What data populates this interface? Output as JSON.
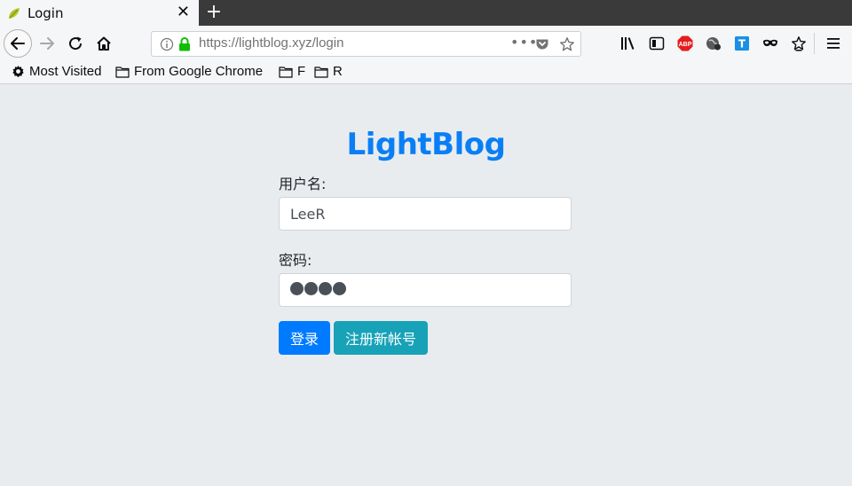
{
  "browser": {
    "tab": {
      "title": "Login",
      "favicon": "spring-leaf-icon"
    },
    "url": "https://lightblog.xyz/login",
    "url_actions": "•••",
    "bookmarks": [
      {
        "label": "Most Visited",
        "icon": "gear-icon"
      },
      {
        "label": "From Google Chrome",
        "icon": "folder-icon"
      },
      {
        "label": "F",
        "icon": "folder-icon"
      },
      {
        "label": "R",
        "icon": "folder-icon"
      }
    ],
    "toolbar_icons": [
      "library-icon",
      "sidebar-icon",
      "adblock-icon",
      "extension-globe-icon",
      "translate-icon",
      "mask-icon",
      "bookmark-star-icon",
      "menu-icon"
    ],
    "adblock_text": "ABP",
    "translate_text": "T"
  },
  "page": {
    "brand": "LightBlog",
    "username_label": "用户名:",
    "username_value": "LeeR",
    "password_label": "密码:",
    "password_length": 4,
    "login_button": "登录",
    "register_button": "注册新帐号"
  },
  "colors": {
    "brand": "#0a7ff5",
    "primary": "#007bff",
    "info": "#17a2b8",
    "background": "#e9ecef"
  }
}
